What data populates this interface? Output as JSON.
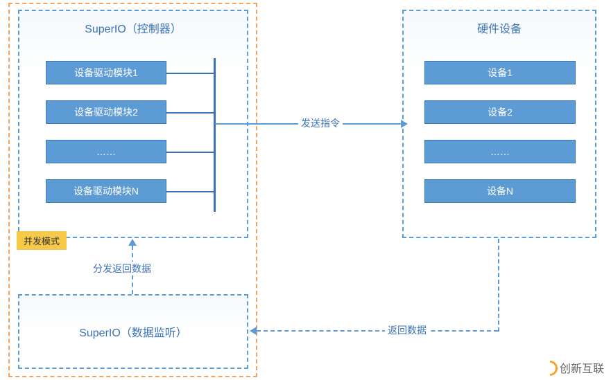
{
  "controller": {
    "title": "SuperIO（控制器）",
    "drivers": [
      "设备驱动模块1",
      "设备驱动模块2",
      "……",
      "设备驱动模块N"
    ]
  },
  "hardware": {
    "title": "硬件设备",
    "devices": [
      "设备1",
      "设备2",
      "……",
      "设备N"
    ]
  },
  "listener": {
    "title": "SuperIO（数据监听）"
  },
  "labels": {
    "send_command": "发送指令",
    "return_data": "返回数据",
    "dispatch_return": "分发返回数据",
    "mode_badge": "并发模式"
  },
  "watermark": "创新互联"
}
